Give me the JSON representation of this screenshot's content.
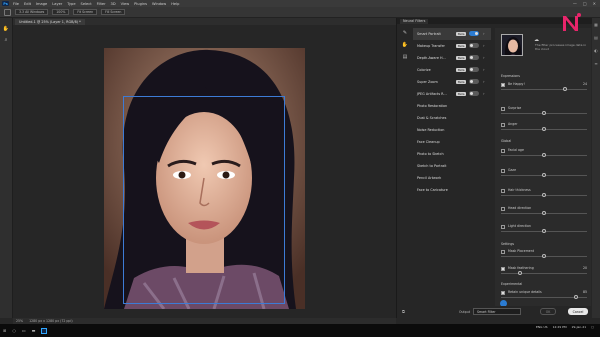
{
  "app": {
    "logo": "Ps",
    "menu": [
      "File",
      "Edit",
      "Image",
      "Layer",
      "Type",
      "Select",
      "Filter",
      "3D",
      "View",
      "Plugins",
      "Window",
      "Help"
    ],
    "window_controls": [
      "—",
      "□",
      "✕"
    ]
  },
  "options": {
    "chips": [
      "3.3 All Windows",
      "100%",
      "Fit Screen",
      "Fill Screen"
    ]
  },
  "document": {
    "tab_title": "Untitled-1 @ 25% (Layer 1, RGB/8) *",
    "zoom": "25%",
    "doc_info": "1280 px x 1280 px (72 ppi)"
  },
  "neural_filters": {
    "title": "Neural Filters",
    "filters": [
      {
        "name": "Smart Portrait",
        "badge": "Beta",
        "toggle": true,
        "active": true
      },
      {
        "name": "Makeup Transfer",
        "badge": "Beta",
        "toggle": false
      },
      {
        "name": "Depth-Aware H...",
        "badge": "Beta",
        "toggle": false
      },
      {
        "name": "Colorize",
        "badge": "Beta",
        "toggle": false
      },
      {
        "name": "Super Zoom",
        "badge": "Beta",
        "toggle": false
      },
      {
        "name": "JPEG Artifacts R...",
        "badge": "Beta",
        "toggle": false
      },
      {
        "name": "Photo Restoration"
      },
      {
        "name": "Dust & Scratches"
      },
      {
        "name": "Noise Reduction"
      },
      {
        "name": "Face Cleanup"
      },
      {
        "name": "Photo to Sketch"
      },
      {
        "name": "Sketch to Portrait"
      },
      {
        "name": "Pencil Artwork"
      },
      {
        "name": "Face to Caricature"
      }
    ],
    "description": "The filter processes image data in the cloud",
    "groups": {
      "expressions": "Expressions",
      "global": "Global",
      "settings": "Settings",
      "experimental": "Experimental"
    },
    "sliders": [
      {
        "label": "Facial age",
        "value": "",
        "pos": 0.5
      },
      {
        "label": "Hair thickness",
        "value": "",
        "pos": 0.5
      },
      {
        "label": "Head direction",
        "value": "",
        "pos": 0.5
      },
      {
        "label": "Light direction",
        "value": "",
        "pos": 0.5
      }
    ],
    "expr_sliders": [
      {
        "label": "Be Happy!",
        "value": "24",
        "pos": 0.72
      },
      {
        "label": "Surprise",
        "value": "",
        "pos": 0.5
      },
      {
        "label": "Anger",
        "value": "",
        "pos": 0.5
      }
    ],
    "gaze": {
      "label": "Gaze",
      "pos": 0.5
    },
    "mask_feathering": {
      "label": "Mask feathering",
      "value": "20",
      "pos": 0.2,
      "checked": true
    },
    "mask_placement": {
      "label": "Mask Placement",
      "checked": false
    },
    "retain_details": {
      "label": "Retain unique details",
      "value": "85",
      "pos": 0.85,
      "checked": true
    },
    "output_label": "Output",
    "output_value": "Smart Filter",
    "ok": "OK",
    "cancel": "Cancel"
  },
  "taskbar": {
    "lang": "ENG US",
    "time": "12:29 PM",
    "date": "29-Jan-21"
  },
  "colors": {
    "accent": "#2b7cd3",
    "selection": "#3d7bd6",
    "brand_pink": "#e8256b"
  }
}
